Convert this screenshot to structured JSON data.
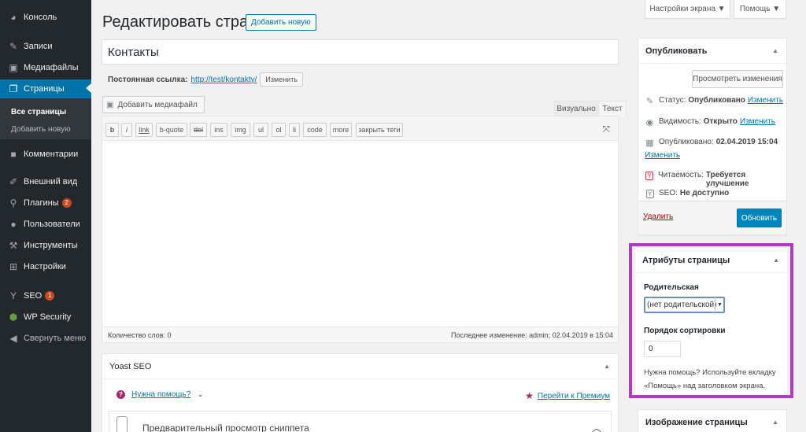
{
  "sidebar": {
    "items": [
      {
        "label": "Консоль",
        "icon": "dashboard-icon"
      },
      {
        "label": "Записи",
        "icon": "pin-icon"
      },
      {
        "label": "Медиафайлы",
        "icon": "media-icon"
      },
      {
        "label": "Страницы",
        "icon": "pages-icon"
      },
      {
        "label": "Комментарии",
        "icon": "comments-icon"
      },
      {
        "label": "Внешний вид",
        "icon": "brush-icon"
      },
      {
        "label": "Плагины",
        "icon": "plugin-icon",
        "badge": "2"
      },
      {
        "label": "Пользователи",
        "icon": "users-icon"
      },
      {
        "label": "Инструменты",
        "icon": "wrench-icon"
      },
      {
        "label": "Настройки",
        "icon": "settings-icon"
      },
      {
        "label": "SEO",
        "icon": "yoast-icon",
        "badge": "1"
      },
      {
        "label": "WP Security",
        "icon": "shield-icon"
      },
      {
        "label": "Свернуть меню",
        "icon": "collapse-icon"
      }
    ],
    "submenu": [
      "Все страницы",
      "Добавить новую"
    ]
  },
  "top": {
    "screen_options": "Настройки экрана ▼",
    "help": "Помощь ▼"
  },
  "heading": {
    "title": "Редактировать страницу",
    "add_new": "Добавить новую"
  },
  "post": {
    "title": "Контакты",
    "permalink_label": "Постоянная ссылка:",
    "permalink_url": "http://test/kontakty/",
    "permalink_edit": "Изменить"
  },
  "editor": {
    "add_media": "Добавить медиафайл",
    "tab_visual": "Визуально",
    "tab_text": "Текст",
    "quicktags": [
      "b",
      "i",
      "link",
      "b-quote",
      "del",
      "ins",
      "img",
      "ul",
      "ol",
      "li",
      "code",
      "more",
      "закрыть теги"
    ],
    "word_count": "Количество слов: 0",
    "last_edit": "Последнее изменение: admin; 02.04.2019 в 15:04"
  },
  "yoast": {
    "title": "Yoast SEO",
    "help": "Нужна помощь?",
    "premium": "Перейти к Премиум",
    "snippet": "Предварительный просмотр сниппета"
  },
  "publish": {
    "title": "Опубликовать",
    "preview": "Просмотреть изменения",
    "status_label": "Статус:",
    "status_value": "Опубликовано",
    "visibility_label": "Видимость:",
    "visibility_value": "Открыто",
    "published_label": "Опубликовано:",
    "published_value": "02.04.2019 15:04",
    "edit": "Изменить",
    "readability_label": "Читаемость:",
    "readability_value": "Требуется улучшение",
    "seo_label": "SEO:",
    "seo_value": "Не доступно",
    "delete": "Удалить",
    "update": "Обновить"
  },
  "attributes": {
    "title": "Атрибуты страницы",
    "parent_label": "Родительская",
    "parent_value": "(нет родительской)",
    "order_label": "Порядок сортировки",
    "order_value": "0",
    "help": "Нужна помощь? Используйте вкладку «Помощь» над заголовком экрана."
  },
  "image_box": {
    "title": "Изображение страницы"
  },
  "colors": {
    "accent": "#0073aa",
    "sidebar": "#23282d",
    "highlight": "#b03cc5",
    "badge": "#ca4a1f"
  }
}
